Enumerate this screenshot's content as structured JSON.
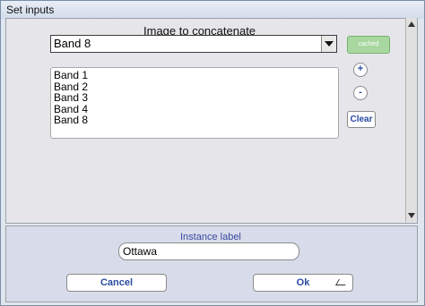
{
  "window": {
    "title": "Set inputs"
  },
  "top": {
    "heading": "Image to concatenate",
    "selected_image": "Band 8",
    "cached_label": "cached",
    "bands": [
      "Band 1",
      "Band 2",
      "Band 3",
      "Band 4",
      "Band 8"
    ],
    "add_label": "+",
    "remove_label": "-",
    "clear_label": "Clear"
  },
  "bottom": {
    "instance_label": "Instance label",
    "instance_value": "Ottawa",
    "cancel_label": "Cancel",
    "ok_label": "Ok"
  }
}
